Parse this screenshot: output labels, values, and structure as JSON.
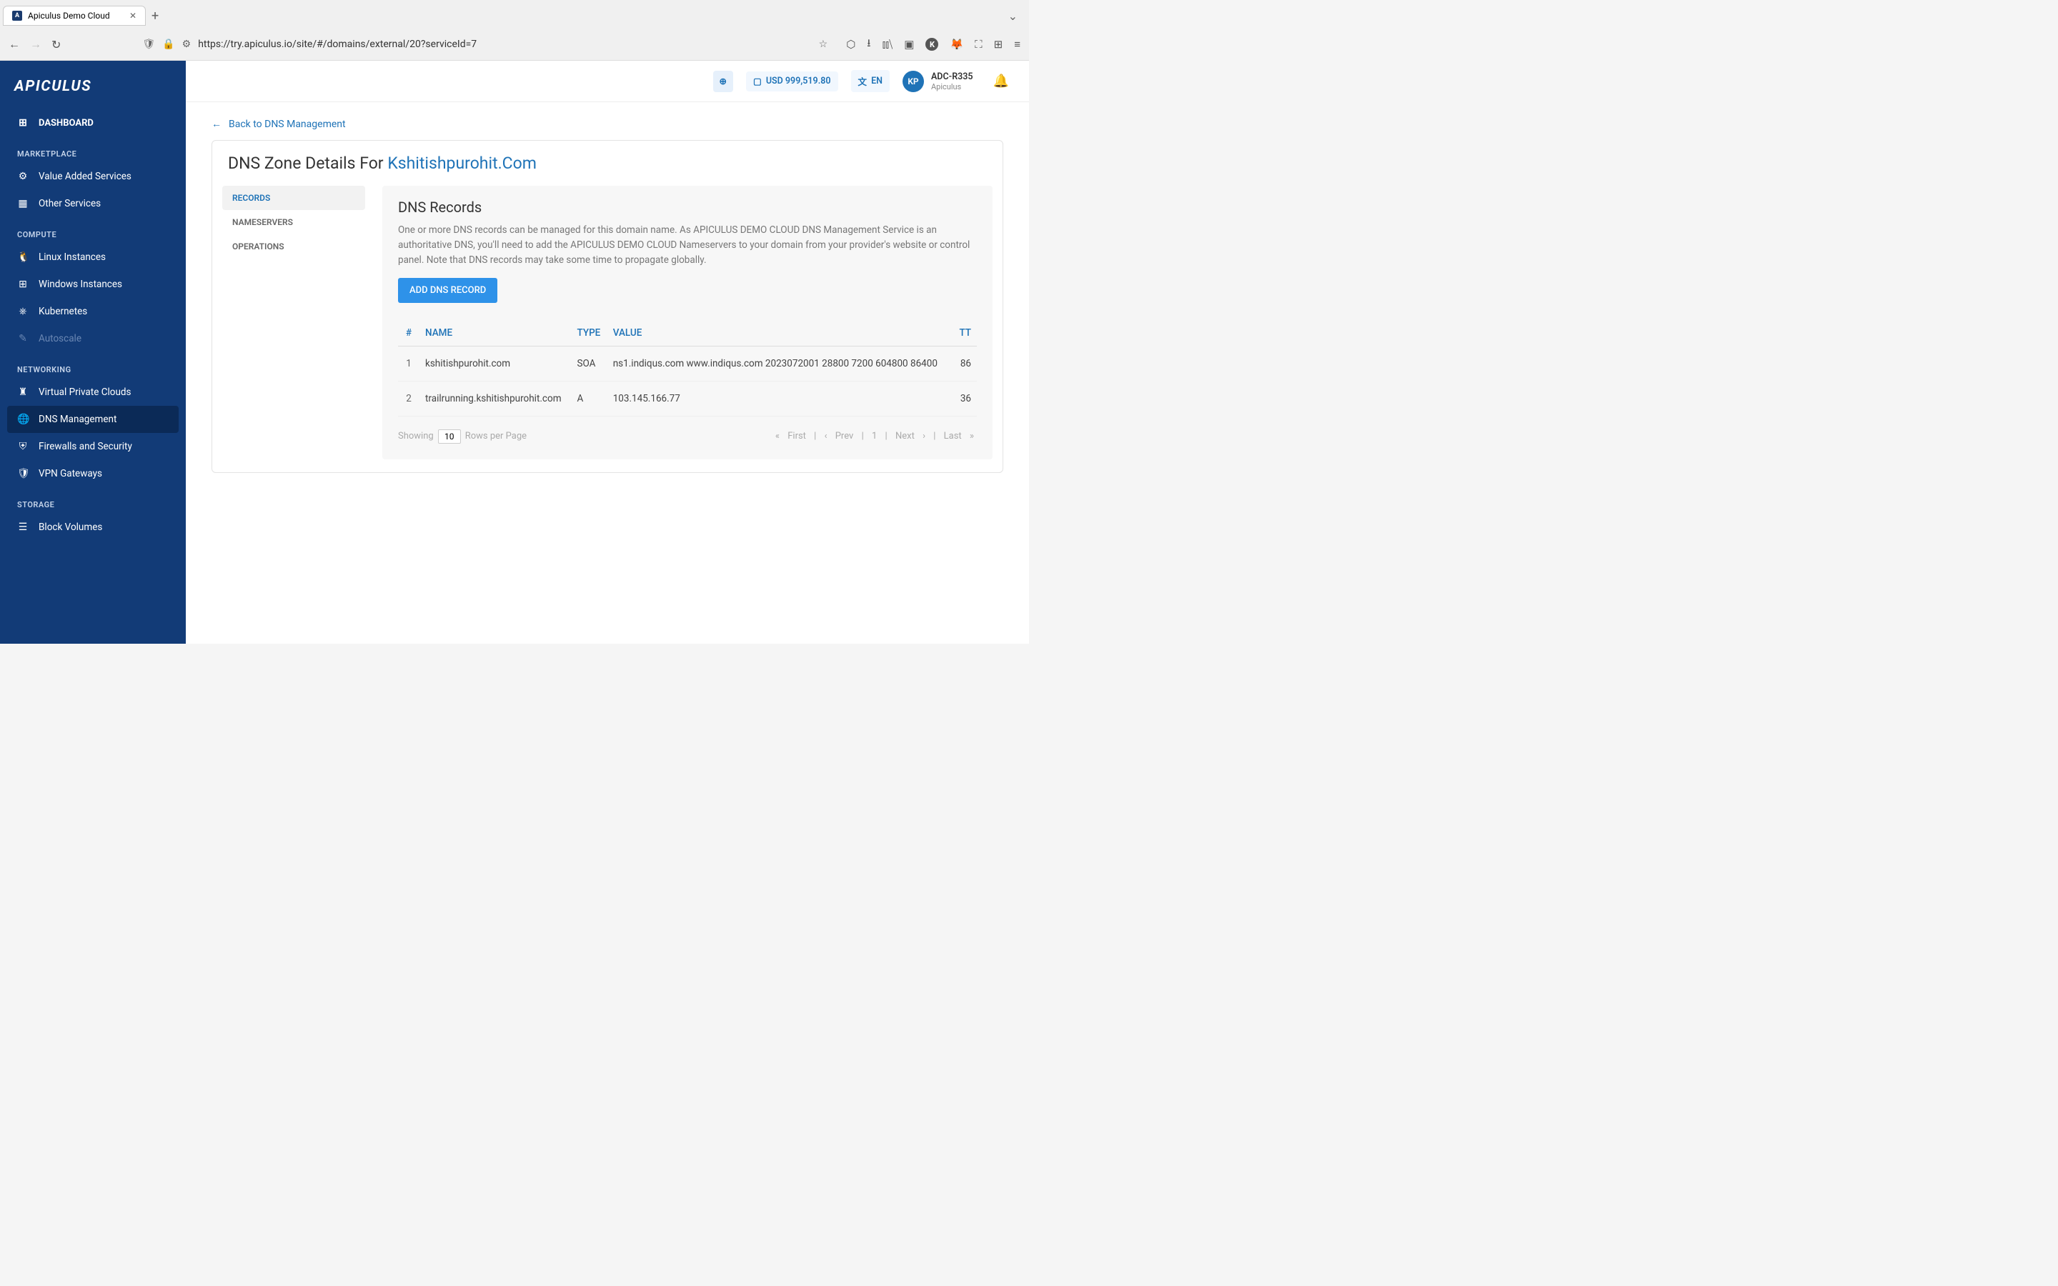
{
  "browser": {
    "tab_title": "Apiculus Demo Cloud",
    "url": "https://try.apiculus.io/site/#/domains/external/20?serviceId=7"
  },
  "sidebar": {
    "logo": "APICULUS",
    "dashboard": "DASHBOARD",
    "headers": {
      "marketplace": "MARKETPLACE",
      "compute": "COMPUTE",
      "networking": "NETWORKING",
      "storage": "STORAGE"
    },
    "items": {
      "vas": "Value Added Services",
      "other": "Other Services",
      "linux": "Linux Instances",
      "windows": "Windows Instances",
      "k8s": "Kubernetes",
      "autoscale": "Autoscale",
      "vpc": "Virtual Private Clouds",
      "dns": "DNS Management",
      "firewall": "Firewalls and Security",
      "vpn": "VPN Gateways",
      "block": "Block Volumes"
    }
  },
  "topbar": {
    "currency": "USD 999,519.80",
    "lang": "EN",
    "avatar": "KP",
    "user_name": "ADC-R335",
    "user_org": "Apiculus"
  },
  "content": {
    "back_link": "Back to DNS Management",
    "title_prefix": "DNS Zone Details For ",
    "title_domain": "Kshitishpurohit.Com",
    "subnav": {
      "records": "RECORDS",
      "nameservers": "NAMESERVERS",
      "operations": "OPERATIONS"
    },
    "panel": {
      "heading": "DNS Records",
      "description": "One or more DNS records can be managed for this domain name. As APICULUS DEMO CLOUD DNS Management Service is an authoritative DNS, you'll need to add the APICULUS DEMO CLOUD Nameservers to your domain from your provider's website or control panel. Note that DNS records may take some time to propagate globally.",
      "add_button": "ADD DNS RECORD"
    },
    "table": {
      "headers": {
        "idx": "#",
        "name": "NAME",
        "type": "TYPE",
        "value": "VALUE",
        "ttl": "TT"
      },
      "rows": [
        {
          "idx": "1",
          "name": "kshitishpurohit.com",
          "type": "SOA",
          "value": "ns1.indiqus.com www.indiqus.com 2023072001 28800 7200 604800 86400",
          "ttl": "86"
        },
        {
          "idx": "2",
          "name": "trailrunning.kshitishpurohit.com",
          "type": "A",
          "value": "103.145.166.77",
          "ttl": "36"
        }
      ]
    },
    "pager": {
      "showing": "Showing",
      "rows_per_page": "Rows per Page",
      "value": "10",
      "first": "First",
      "prev": "Prev",
      "page": "1",
      "next": "Next",
      "last": "Last"
    }
  }
}
